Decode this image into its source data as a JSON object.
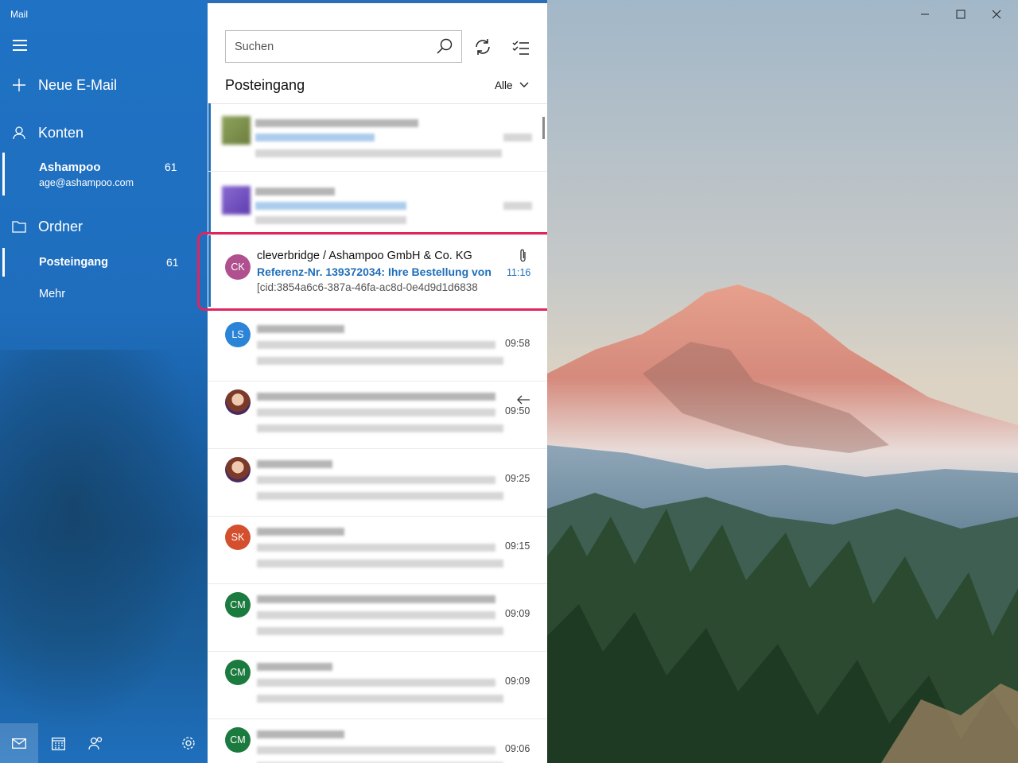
{
  "app": {
    "title": "Mail"
  },
  "sidebar": {
    "new_mail": "Neue E-Mail",
    "accounts_header": "Konten",
    "account": {
      "name": "Ashampoo",
      "email": "age@ashampoo.com",
      "count": "61"
    },
    "folders_header": "Ordner",
    "folder": {
      "name": "Posteingang",
      "count": "61"
    },
    "more": "Mehr",
    "bottom_icons": [
      "mail-icon",
      "calendar-icon",
      "people-icon",
      "settings-icon"
    ]
  },
  "list": {
    "search_placeholder": "Suchen",
    "title": "Posteingang",
    "filter": "Alle",
    "highlighted": {
      "initials": "CK",
      "avatar_color": "#b0508f",
      "sender": "cleverbridge / Ashampoo GmbH & Co. KG",
      "subject": "Referenz-Nr. 139372034: Ihre Bestellung von",
      "preview": "[cid:3854a6c6-387a-46fa-ac8d-0e4d9d1d6838",
      "time": "11:16"
    },
    "messages": [
      {
        "initials": "LS",
        "color": "#2b84d6",
        "time": "09:58"
      },
      {
        "initials": "",
        "color": "#9a6a5a",
        "time": "09:50"
      },
      {
        "initials": "",
        "color": "#9a6a5a",
        "time": "09:25"
      },
      {
        "initials": "SK",
        "color": "#d34f2e",
        "time": "09:15"
      },
      {
        "initials": "CM",
        "color": "#1b7a3e",
        "time": "09:09"
      },
      {
        "initials": "CM",
        "color": "#1b7a3e",
        "time": "09:09"
      },
      {
        "initials": "CM",
        "color": "#1b7a3e",
        "time": "09:06"
      }
    ]
  },
  "colors": {
    "accent": "#1f6eb8",
    "highlight_border": "#e0245e",
    "sidebar": "#1f72c4"
  }
}
